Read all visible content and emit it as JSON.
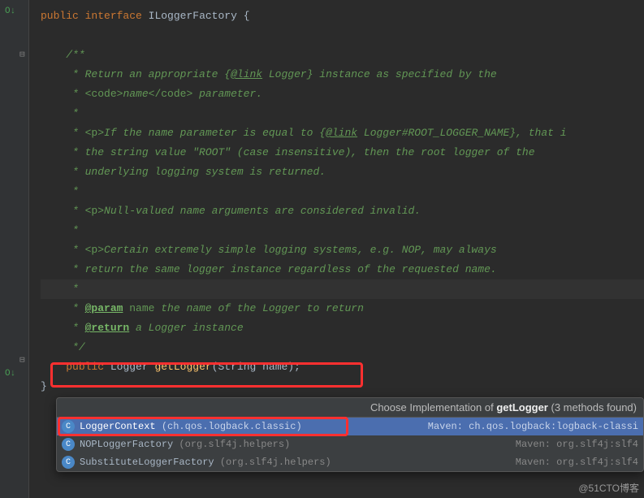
{
  "code": {
    "declaration_public": "public",
    "declaration_interface": "interface",
    "interface_name": "ILoggerFactory",
    "open_brace": "{",
    "close_brace": "}",
    "doc_open": "/**",
    "doc_star": " *",
    "doc_l1a": " * Return an appropriate {",
    "doc_l1_link": "@link",
    "doc_l1b": " Logger",
    "doc_l1c": "} instance as specified by the",
    "doc_l2a": " * ",
    "doc_l2_tag1": "<code>",
    "doc_l2_name": "name",
    "doc_l2_tag2": "</code>",
    "doc_l2b": " parameter.",
    "doc_l3a": " * ",
    "doc_l3_p": "<p>",
    "doc_l3b": "If the name parameter is equal to {",
    "doc_l3_link": "@link",
    "doc_l3c": " Logger#ROOT_LOGGER_NAME",
    "doc_l3d": "}, that i",
    "doc_l4": " * the string value \"ROOT\" (case insensitive), then the root logger of the",
    "doc_l5": " * underlying logging system is returned.",
    "doc_l6a": " * ",
    "doc_l6_p": "<p>",
    "doc_l6b": "Null-valued name arguments are considered invalid.",
    "doc_l7a": " * ",
    "doc_l7_p": "<p>",
    "doc_l7b": "Certain extremely simple logging systems, e.g. NOP, may always",
    "doc_l8": " * return the same logger instance regardless of the requested name.",
    "doc_param_tag": "@param",
    "doc_param_name": " name",
    "doc_param_desc": " the name of the Logger to return",
    "doc_return_tag": "@return",
    "doc_return_desc": " a Logger instance",
    "doc_close": " */",
    "method_public": "public",
    "method_ret": "Logger",
    "method_name": "getLogger",
    "method_args": "(String name);"
  },
  "popup": {
    "title_prefix": "Choose Implementation of ",
    "title_method": "getLogger",
    "title_suffix": " (3 methods found)",
    "items": [
      {
        "icon": "C",
        "name": "LoggerContext",
        "pkg": "(ch.qos.logback.classic)",
        "maven": "Maven: ch.qos.logback:logback-classi"
      },
      {
        "icon": "C",
        "name": "NOPLoggerFactory",
        "pkg": "(org.slf4j.helpers)",
        "maven": "Maven: org.slf4j:slf4"
      },
      {
        "icon": "C",
        "name": "SubstituteLoggerFactory",
        "pkg": "(org.slf4j.helpers)",
        "maven": "Maven: org.slf4j:slf4"
      }
    ]
  },
  "gutter": {
    "override1": "O↓",
    "override2": "O↓"
  },
  "watermark": "@51CTO博客"
}
